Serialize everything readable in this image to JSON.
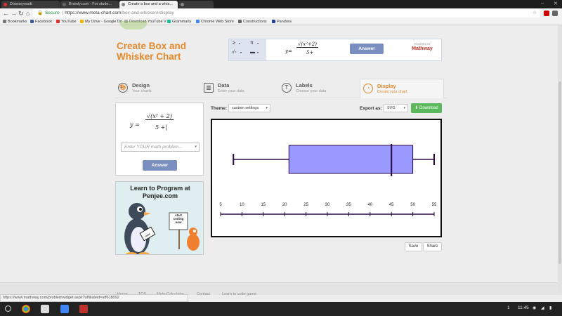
{
  "tabs": [
    {
      "label": "Dotsoeywadt",
      "color": "#d33"
    },
    {
      "label": "Brainly.com - For stude...",
      "color": "#444"
    },
    {
      "label": "Create a box and a whis...",
      "color": "#888"
    },
    {
      "label": "",
      "color": "#888"
    }
  ],
  "window_controls": {
    "minimize": "–",
    "close": "✕"
  },
  "nav": {
    "back": "←",
    "forward": "→",
    "reload": "↻",
    "home": "⌂"
  },
  "omnibox": {
    "lock": "🔒",
    "secure": "Secure",
    "scheme_sep": "|",
    "url_host": "https://www.meta-chart.com",
    "url_path": "/box-and-whisker#/display",
    "star": "☆"
  },
  "bookmarks": [
    {
      "label": "Bookmarks",
      "color": "#777"
    },
    {
      "label": "Facebook",
      "color": "#3b5998"
    },
    {
      "label": "YouTube",
      "color": "#e52d27"
    },
    {
      "label": "My Drive - Google Dri",
      "color": "#f4b400"
    },
    {
      "label": "Download YouTube V",
      "color": "#aaa"
    },
    {
      "label": "Grammarly",
      "color": "#15c39a"
    },
    {
      "label": "Chrome Web Store",
      "color": "#4285f4"
    },
    {
      "label": "Constructions",
      "color": "#666"
    },
    {
      "label": "Pandora",
      "color": "#224099"
    }
  ],
  "site": {
    "title_line1": "Create Box and",
    "title_line2": "Whisker Chart"
  },
  "mathway_top": {
    "keys": [
      "≥",
      "π",
      "√▫",
      "▬"
    ],
    "expr_lhs": "y=",
    "expr_num": "√(x²+2)",
    "expr_den": "5+",
    "answer": "Answer",
    "powered": "POWERED BY",
    "brand": "Mathway"
  },
  "steps": [
    {
      "title": "Design",
      "sub": "Your charts",
      "icon": "🎨"
    },
    {
      "title": "Data",
      "sub": "Enter your data",
      "icon": "▥"
    },
    {
      "title": "Labels",
      "sub": "Choose your data",
      "icon": "T"
    },
    {
      "title": "Display",
      "sub": "Create your chart",
      "icon": "◔"
    }
  ],
  "mathway_left": {
    "expr_lhs": "y =",
    "expr_num": "√(x²  + 2)",
    "expr_den": "5 +|",
    "placeholder": "Enter YOUR math problem...",
    "answer": "Answer"
  },
  "ad": {
    "line1": "Learn to Program at",
    "line2": "Penjee.com",
    "sign": "start coding now",
    "laptop": "code"
  },
  "controls": {
    "theme_label": "Theme:",
    "theme_value": "custom settings",
    "export_label": "Export as:",
    "export_value": "SVG",
    "download": "Download",
    "download_icon": "⬇",
    "save": "Save",
    "share": "Share"
  },
  "chart_data": {
    "type": "box",
    "xlim": [
      5,
      55
    ],
    "ticks": [
      5,
      10,
      15,
      20,
      25,
      30,
      35,
      40,
      45,
      50,
      55
    ],
    "tick_labels": [
      "5",
      "10",
      "15",
      "20",
      "25",
      "30",
      "35",
      "40",
      "45",
      "50",
      "55"
    ],
    "min": 8,
    "q1": 21,
    "median": 45,
    "q3": 50,
    "max": 55,
    "box_color": "#9999ff",
    "line_color": "#2e0a4a"
  },
  "footer": [
    "Home",
    "TOS",
    "Meta-Calculator",
    "Contact",
    "Learn to code game"
  ],
  "status_url": "https://www.mathway.com/problemwidget.aspx?affiliateid=aff618092",
  "shelf": {
    "page_indicator": "1",
    "time": "11:45",
    "apps": [
      "#555",
      "#dcdcdc",
      "#c5221f",
      "#4285f4",
      "#c4302b"
    ]
  }
}
